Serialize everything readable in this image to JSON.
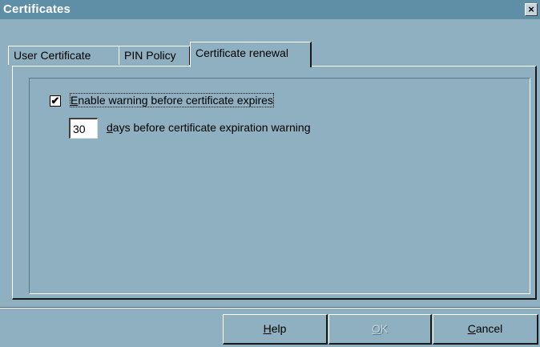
{
  "window": {
    "title": "Certificates",
    "close_glyph": "×"
  },
  "tabs": [
    {
      "label": "User Certificate",
      "active": false
    },
    {
      "label": "PIN Policy",
      "active": false
    },
    {
      "label": "Certificate renewal",
      "active": true
    }
  ],
  "renewal": {
    "enable_warning": {
      "checked": true,
      "label_accel": "E",
      "label_rest": "nable warning before certificate expires"
    },
    "days": {
      "value": "30",
      "label_accel": "d",
      "label_rest": "ays before certificate expiration warning"
    }
  },
  "buttons": {
    "help": {
      "accel": "H",
      "rest": "elp",
      "enabled": true
    },
    "ok": {
      "accel": "O",
      "rest": "K",
      "enabled": false
    },
    "cancel": {
      "accel": "C",
      "rest": "ancel",
      "enabled": true
    }
  },
  "colors": {
    "face": "#8fb0c0",
    "titlebar": "#5f8fa7",
    "title_text": "#ffffff",
    "disabled_text": "#c4d6df"
  },
  "icons": {
    "checkbox_mark": "check-mark-icon",
    "close": "close-icon"
  }
}
